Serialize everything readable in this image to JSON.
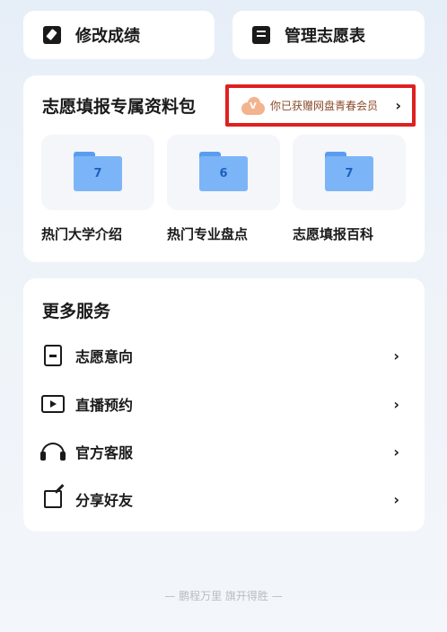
{
  "top_actions": {
    "edit_scores": "修改成绩",
    "manage_list": "管理志愿表"
  },
  "pack": {
    "title": "志愿填报专属资料包",
    "badge_text": "你已获赠网盘青春会员",
    "badge_icon_letter": "V",
    "folders": [
      {
        "count": "7",
        "label": "热门大学介绍"
      },
      {
        "count": "6",
        "label": "热门专业盘点"
      },
      {
        "count": "7",
        "label": "志愿填报百科"
      }
    ]
  },
  "more": {
    "title": "更多服务",
    "items": [
      {
        "label": "志愿意向",
        "icon": "document-icon"
      },
      {
        "label": "直播预约",
        "icon": "play-icon"
      },
      {
        "label": "官方客服",
        "icon": "headset-icon"
      },
      {
        "label": "分享好友",
        "icon": "share-icon"
      }
    ]
  },
  "chevron": "›",
  "footer": "— 鹏程万里 旗开得胜 —",
  "colors": {
    "highlight_border": "#e02020",
    "folder_blue": "#7cb5f7",
    "badge_text": "#8a4a2a"
  }
}
